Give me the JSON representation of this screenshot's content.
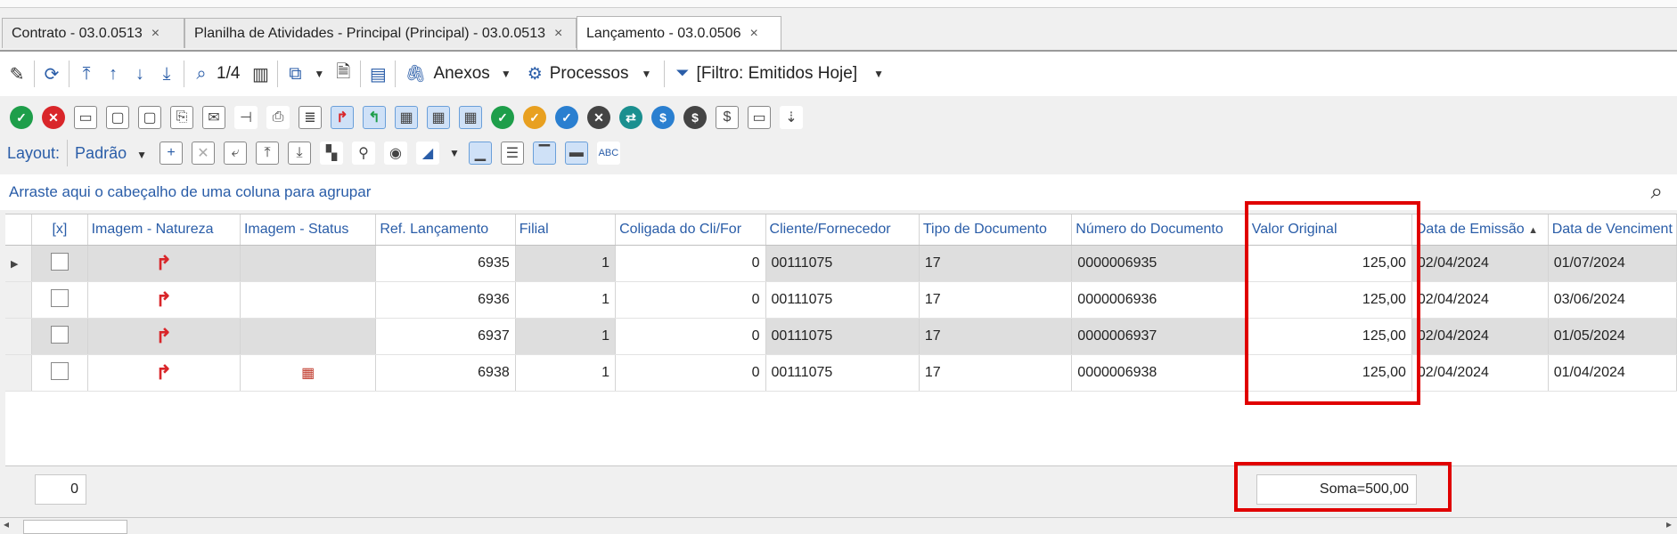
{
  "tabs": [
    {
      "label": "Contrato - 03.0.0513",
      "close": "×"
    },
    {
      "label": "Planilha de Atividades - Principal (Principal) - 03.0.0513",
      "close": "×"
    },
    {
      "label": "Lançamento - 03.0.0506",
      "close": "×"
    }
  ],
  "toolbar": {
    "page_indicator": "1/4",
    "anexos_label": "Anexos",
    "processos_label": "Processos",
    "filter_label": "[Filtro: Emitidos Hoje]"
  },
  "layout_bar": {
    "layout_label": "Layout:",
    "layout_value": "Padrão"
  },
  "groupbar": {
    "hint": "Arraste aqui o cabeçalho de uma coluna para agrupar"
  },
  "grid": {
    "columns": [
      "[x]",
      "Imagem - Natureza",
      "Imagem - Status",
      "Ref. Lançamento",
      "Filial",
      "Coligada do Cli/For",
      "Cliente/Fornecedor",
      "Tipo de Documento",
      "Número do Documento",
      "Valor Original",
      "Data de Emissão",
      "Data de Venciment"
    ],
    "rows": [
      {
        "ref": "6935",
        "filial": "1",
        "coligada": "0",
        "cliente": "00111075",
        "tipo": "17",
        "numero": "0000006935",
        "valor": "125,00",
        "emissao": "02/04/2024",
        "vencimento": "01/07/2024"
      },
      {
        "ref": "6936",
        "filial": "1",
        "coligada": "0",
        "cliente": "00111075",
        "tipo": "17",
        "numero": "0000006936",
        "valor": "125,00",
        "emissao": "02/04/2024",
        "vencimento": "03/06/2024"
      },
      {
        "ref": "6937",
        "filial": "1",
        "coligada": "0",
        "cliente": "00111075",
        "tipo": "17",
        "numero": "0000006937",
        "valor": "125,00",
        "emissao": "02/04/2024",
        "vencimento": "01/05/2024"
      },
      {
        "ref": "6938",
        "filial": "1",
        "coligada": "0",
        "cliente": "00111075",
        "tipo": "17",
        "numero": "0000006938",
        "valor": "125,00",
        "emissao": "02/04/2024",
        "vencimento": "01/04/2024"
      }
    ]
  },
  "footer": {
    "count": "0",
    "sum": "Soma=500,00"
  },
  "colors": {
    "accent": "#2a5da8",
    "highlight_box": "#e00000",
    "natureza_icon": "#d9262a"
  }
}
